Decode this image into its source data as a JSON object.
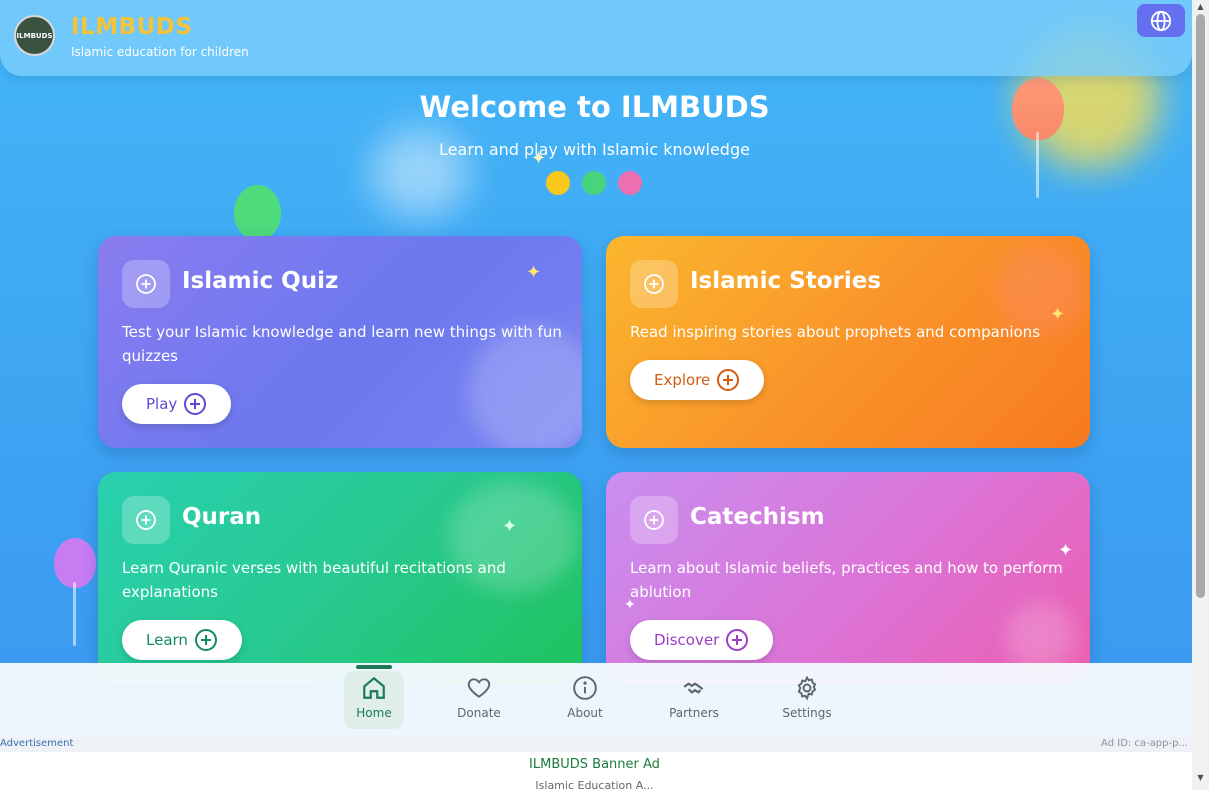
{
  "header": {
    "logo_text": "ILMBUDS",
    "brand_name": "ILMBUDS",
    "tagline": "Islamic education for children",
    "language_icon": "globe-icon"
  },
  "hero": {
    "title": "Welcome to ILMBUDS",
    "subtitle": "Learn and play with Islamic knowledge",
    "dot_colors": [
      "#f8c81c",
      "#46d47c",
      "#ec6fb0"
    ]
  },
  "cards": [
    {
      "title": "Islamic Quiz",
      "description": "Test your Islamic knowledge and learn new things with fun quizzes",
      "button": "Play",
      "accent": "#5b4bd0"
    },
    {
      "title": "Islamic Stories",
      "description": "Read inspiring stories about prophets and companions",
      "button": "Explore",
      "accent": "#d65a14"
    },
    {
      "title": "Quran",
      "description": "Learn Quranic verses with beautiful recitations and explanations",
      "button": "Learn",
      "accent": "#138a5f"
    },
    {
      "title": "Catechism",
      "description": "Learn about Islamic beliefs, practices and how to perform ablution",
      "button": "Discover",
      "accent": "#9c3cc8"
    }
  ],
  "nav": {
    "items": [
      {
        "label": "Home",
        "icon": "home-icon",
        "active": true
      },
      {
        "label": "Donate",
        "icon": "heart-icon",
        "active": false
      },
      {
        "label": "About",
        "icon": "info-icon",
        "active": false
      },
      {
        "label": "Partners",
        "icon": "handshake-icon",
        "active": false
      },
      {
        "label": "Settings",
        "icon": "gear-icon",
        "active": false
      }
    ]
  },
  "ad": {
    "label": "Advertisement",
    "ad_id": "Ad ID: ca-app-p...",
    "title": "ILMBUDS Banner Ad",
    "subtitle": "Islamic Education A..."
  }
}
